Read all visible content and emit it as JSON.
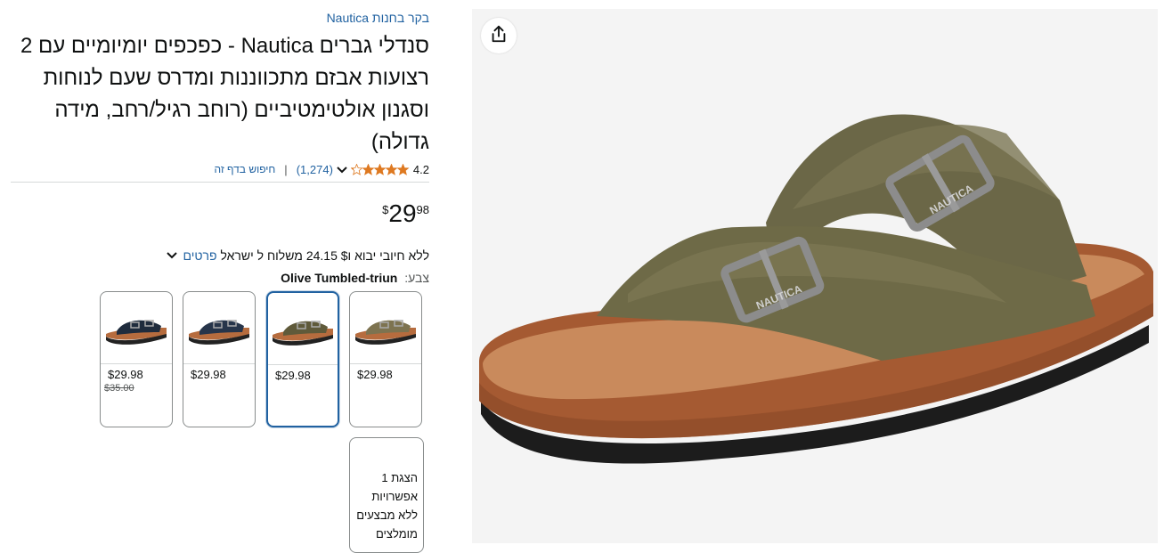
{
  "product": {
    "brand_link": "בקר בחנות Nautica",
    "title": "סנדלי גברים Nautica - כפכפים יומיומיים עם 2 רצועות אבזם מתכווננות ומדרס שעם לנוחות וסגנון אולטימטיביים (רוחב רגיל/רחב, מידה גדולה)",
    "rating": {
      "value": "4.2",
      "stars": 4.2,
      "count": "(1,274)",
      "search_link": "חיפוש בדף זה"
    },
    "price": {
      "symbol": "$",
      "whole": "29",
      "fraction": "98"
    },
    "shipping": {
      "text": "ללא חיובי יבוא ו‎24.15 $‎ משלוח ל ישראל",
      "details_link": "פרטים"
    },
    "color": {
      "label": "צבע:",
      "value": "Olive Tumbled-triun"
    },
    "swatches": [
      {
        "price": "$29.98",
        "list_price": "",
        "shoe_color": "#7d7350",
        "selected": false
      },
      {
        "price": "$29.98",
        "list_price": "",
        "shoe_color": "#5f5a3a",
        "selected": true
      },
      {
        "price": "$29.98",
        "list_price": "",
        "shoe_color": "#27354a",
        "selected": false
      },
      {
        "price": "$29.98",
        "list_price": "$35.00",
        "shoe_color": "#1f2c3d",
        "selected": false
      }
    ],
    "more_options": "הצגת 1 אפשרויות ללא מבצעים מומלצים"
  },
  "colors": {
    "link": "#2162a1",
    "star": "#de7921",
    "selected_border": "#2162a1",
    "image_bg": "#f4f4f4"
  },
  "icons": {
    "share": "share-icon",
    "chevron": "chevron-down-icon"
  }
}
